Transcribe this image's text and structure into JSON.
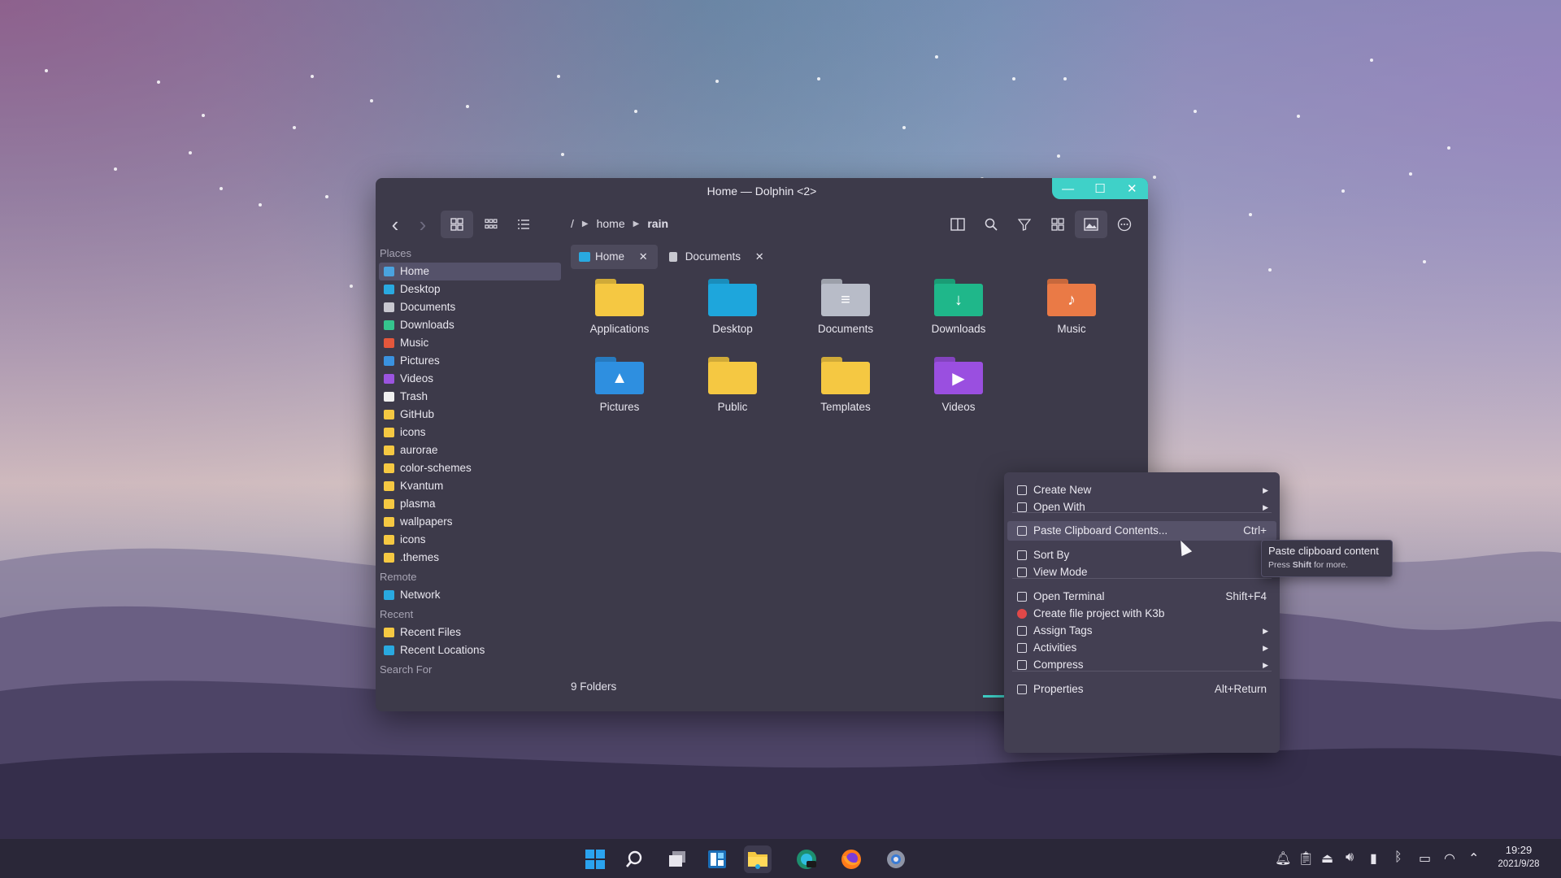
{
  "window": {
    "title": "Home — Dolphin <2>",
    "controls": {
      "minimize": "—",
      "maximize": "☐",
      "close": "✕"
    }
  },
  "toolbar": {
    "back": "‹",
    "forward": "›",
    "breadcrumb": [
      "/",
      "home",
      "rain"
    ]
  },
  "sidebar": {
    "places_header": "Places",
    "places": [
      {
        "label": "Home",
        "color": "#4aa3df"
      },
      {
        "label": "Desktop",
        "color": "#29a9e0"
      },
      {
        "label": "Documents",
        "color": "#c8c8d0"
      },
      {
        "label": "Downloads",
        "color": "#35c48d"
      },
      {
        "label": "Music",
        "color": "#e4573c"
      },
      {
        "label": "Pictures",
        "color": "#3a92e0"
      },
      {
        "label": "Videos",
        "color": "#9b54e0"
      },
      {
        "label": "Trash",
        "color": "#f0f0f0"
      },
      {
        "label": "GitHub",
        "color": "#f5c842"
      },
      {
        "label": "icons",
        "color": "#f5c842"
      },
      {
        "label": "aurorae",
        "color": "#f5c842"
      },
      {
        "label": "color-schemes",
        "color": "#f5c842"
      },
      {
        "label": "Kvantum",
        "color": "#f5c842"
      },
      {
        "label": "plasma",
        "color": "#f5c842"
      },
      {
        "label": "wallpapers",
        "color": "#f5c842"
      },
      {
        "label": "icons",
        "color": "#f5c842"
      },
      {
        "label": ".themes",
        "color": "#f5c842"
      }
    ],
    "remote_header": "Remote",
    "remote": [
      {
        "label": "Network",
        "color": "#29a9e0"
      }
    ],
    "recent_header": "Recent",
    "recent": [
      {
        "label": "Recent Files",
        "color": "#f5c842"
      },
      {
        "label": "Recent Locations",
        "color": "#29a9e0"
      }
    ],
    "search_header": "Search For"
  },
  "tabs": [
    {
      "label": "Home",
      "close": "✕"
    },
    {
      "label": "Documents",
      "close": "✕"
    }
  ],
  "files": [
    {
      "label": "Applications",
      "color": "#f5c842",
      "glyph": ""
    },
    {
      "label": "Desktop",
      "color": "#1ea6dc",
      "glyph": ""
    },
    {
      "label": "Documents",
      "color": "#b8bcc8",
      "glyph": "≡"
    },
    {
      "label": "Downloads",
      "color": "#1fb78a",
      "glyph": "↓"
    },
    {
      "label": "Music",
      "color": "#ea7a46",
      "glyph": "♪"
    },
    {
      "label": "Pictures",
      "color": "#2e8fe0",
      "glyph": "▲"
    },
    {
      "label": "Public",
      "color": "#f5c842",
      "glyph": ""
    },
    {
      "label": "Templates",
      "color": "#f5c842",
      "glyph": ""
    },
    {
      "label": "Videos",
      "color": "#9a4fe0",
      "glyph": "▶"
    }
  ],
  "status": {
    "text": "9 Folders"
  },
  "context_menu": {
    "items": [
      {
        "label": "Create New",
        "shortcut": "",
        "arrow": "▶"
      },
      {
        "label": "Open With",
        "shortcut": "",
        "arrow": "▶"
      },
      {
        "label": "Paste Clipboard Contents...",
        "shortcut": "Ctrl+",
        "arrow": ""
      },
      {
        "label": "Sort By",
        "shortcut": "",
        "arrow": ""
      },
      {
        "label": "View Mode",
        "shortcut": "",
        "arrow": "▶"
      },
      {
        "label": "Open Terminal",
        "shortcut": "Shift+F4",
        "arrow": ""
      },
      {
        "label": "Create file project with K3b",
        "shortcut": "",
        "arrow": ""
      },
      {
        "label": "Assign Tags",
        "shortcut": "",
        "arrow": "▶"
      },
      {
        "label": "Activities",
        "shortcut": "",
        "arrow": "▶"
      },
      {
        "label": "Compress",
        "shortcut": "",
        "arrow": "▶"
      },
      {
        "label": "Properties",
        "shortcut": "Alt+Return",
        "arrow": ""
      }
    ]
  },
  "tooltip": {
    "title": "Paste clipboard content",
    "hint_pre": "Press ",
    "hint_key": "Shift",
    "hint_post": " for more."
  },
  "taskbar": {
    "clock_time": "19:29",
    "clock_date": "2021/9/28"
  }
}
